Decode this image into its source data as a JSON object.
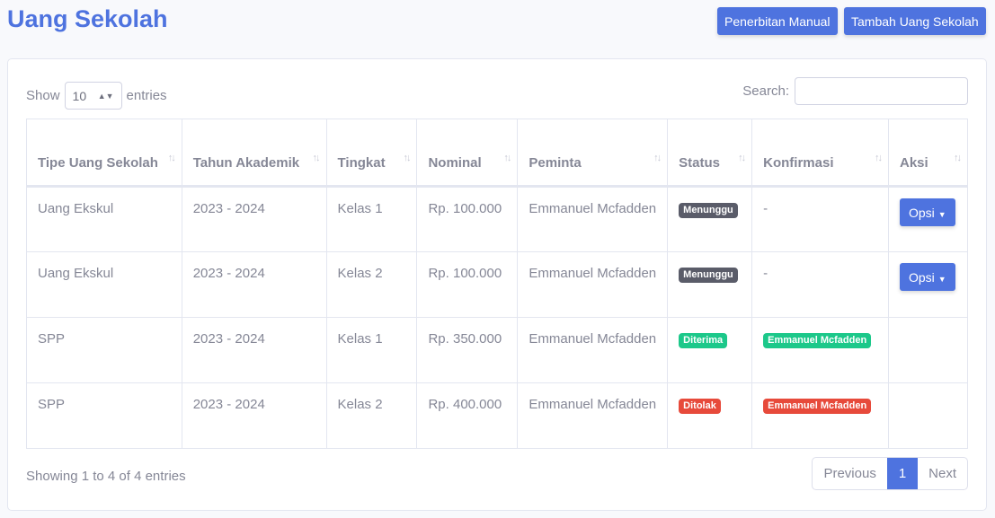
{
  "header": {
    "title": "Uang Sekolah",
    "btn_manual": "Penerbitan Manual",
    "btn_add": "Tambah Uang Sekolah"
  },
  "controls": {
    "show": "Show",
    "entries_value": "10",
    "entries": "entries",
    "search_label": "Search:",
    "search_value": ""
  },
  "columns": [
    "Tipe Uang Sekolah",
    "Tahun Akademik",
    "Tingkat",
    "Nominal",
    "Peminta",
    "Status",
    "Konfirmasi",
    "Aksi"
  ],
  "rows": [
    {
      "tipe": "Uang Ekskul",
      "tahun": "2023 - 2024",
      "tingkat": "Kelas 1",
      "nominal": "Rp. 100.000",
      "peminta": "Emmanuel Mcfadden",
      "status": "Menunggu",
      "status_color": "#5a5c69",
      "konfirmasi": "-",
      "konfirmasi_badge": false,
      "aksi": "Opsi"
    },
    {
      "tipe": "Uang Ekskul",
      "tahun": "2023 - 2024",
      "tingkat": "Kelas 2",
      "nominal": "Rp. 100.000",
      "peminta": "Emmanuel Mcfadden",
      "status": "Menunggu",
      "status_color": "#5a5c69",
      "konfirmasi": "-",
      "konfirmasi_badge": false,
      "aksi": "Opsi"
    },
    {
      "tipe": "SPP",
      "tahun": "2023 - 2024",
      "tingkat": "Kelas 1",
      "nominal": "Rp. 350.000",
      "peminta": "Emmanuel Mcfadden",
      "status": "Diterima",
      "status_color": "#1cc88a",
      "konfirmasi": "Emmanuel Mcfadden",
      "konfirmasi_badge": true,
      "aksi": ""
    },
    {
      "tipe": "SPP",
      "tahun": "2023 - 2024",
      "tingkat": "Kelas 2",
      "nominal": "Rp. 400.000",
      "peminta": "Emmanuel Mcfadden",
      "status": "Ditolak",
      "status_color": "#e74a3b",
      "konfirmasi": "Emmanuel Mcfadden",
      "konfirmasi_badge": true,
      "aksi": ""
    }
  ],
  "footer": {
    "info": "Showing 1 to 4 of 4 entries",
    "previous": "Previous",
    "page": "1",
    "next": "Next"
  },
  "colors": {
    "primary": "#4e73df"
  }
}
